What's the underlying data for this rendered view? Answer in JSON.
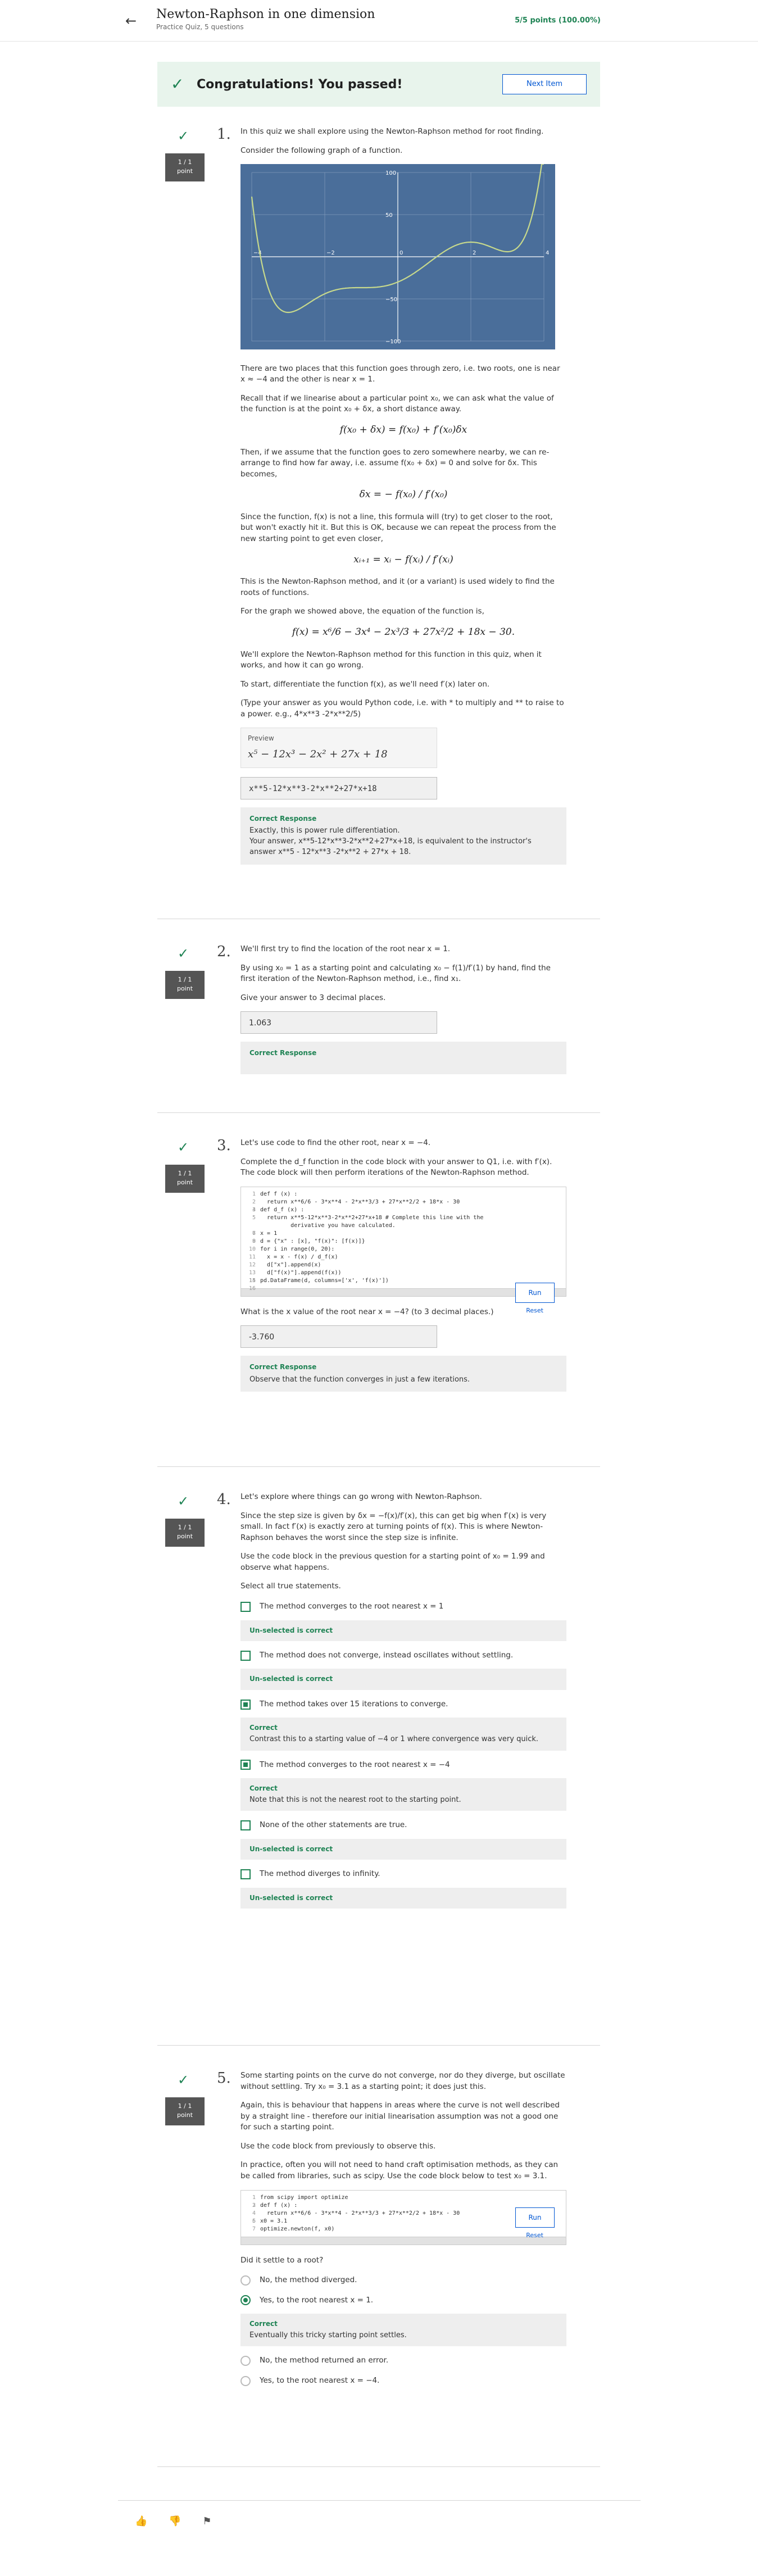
{
  "header": {
    "title": "Newton-Raphson in one dimension",
    "subtitle": "Practice Quiz, 5 questions",
    "score": "5/5 points (100.00%)"
  },
  "banner": {
    "message": "Congratulations! You passed!",
    "next_label": "Next Item"
  },
  "points_label": "1 / 1",
  "points_unit": "point",
  "q1": {
    "number": "1.",
    "p1": "In this quiz we shall explore using the Newton-Raphson method for root finding.",
    "p2": "Consider the following graph of a function.",
    "p3": "There are two places that this function goes through zero, i.e. two roots, one is near x ≈ −4 and the other is near x = 1.",
    "p4": "Recall that if we linearise about a particular point x₀, we can ask what the value of the function is at the point x₀ + δx, a short distance away.",
    "eq1": "f(x₀ + δx) = f(x₀) + f′(x₀)δx",
    "p5": "Then, if we assume that the function goes to zero somewhere nearby, we can re-arrange to find how far away, i.e. assume f(x₀ + δx) = 0 and solve for δx. This becomes,",
    "eq2": "δx = − f(x₀) / f′(x₀)",
    "p6": "Since the function, f(x) is not a line, this formula will (try) to get closer to the root, but won't exactly hit it. But this is OK, because we can repeat the process from the new starting point to get even closer,",
    "eq3": "xᵢ₊₁ = xᵢ − f(xᵢ) / f′(xᵢ)",
    "p7": "This is the Newton-Raphson method, and it (or a variant) is used widely to find the roots of functions.",
    "p8": "For the graph we showed above, the equation of the function is,",
    "eq4": "f(x) = x⁶/6 − 3x⁴ − 2x³/3 + 27x²/2 + 18x − 30.",
    "p9": "We'll explore the Newton-Raphson method for this function in this quiz, when it works, and how it can go wrong.",
    "p10": "To start, differentiate the function f(x), as we'll need f′(x) later on.",
    "p11": "(Type your answer as you would Python code, i.e. with * to multiply and ** to raise to a power. e.g., 4*x**3 -2*x**2/5)",
    "preview_label": "Preview",
    "preview_value": "x⁵ − 12x³ − 2x² + 27x + 18",
    "answer": "x**5-12*x**3-2*x**2+27*x+18",
    "resp_title": "Correct Response",
    "resp_line1": "Exactly, this is power rule differentiation.",
    "resp_line2": "Your answer, x**5-12*x**3-2*x**2+27*x+18, is equivalent to the instructor's answer x**5 - 12*x**3 -2*x**2 + 27*x + 18."
  },
  "chart_data": {
    "type": "line",
    "title": "",
    "xlabel": "",
    "ylabel": "",
    "xlim": [
      -4,
      4
    ],
    "ylim": [
      -100,
      100
    ],
    "xticks": [
      "−4",
      "−2",
      "0",
      "2",
      "4"
    ],
    "yticks": [
      "100",
      "50",
      "0",
      "−50",
      "−100"
    ],
    "grid": true,
    "colors": {
      "background": "#4a6e9a",
      "line": "#c7d98c",
      "grid": "#8ea6c4"
    },
    "function": "x^6/6 - 3x^4 - 2x^3/3 + 27x^2/2 + 18x - 30"
  },
  "q2": {
    "number": "2.",
    "p1": "We'll first try to find the location of the root near x = 1.",
    "p2": "By using x₀ = 1 as a starting point and calculating x₀ − f(1)/f′(1) by hand, find the first iteration of the Newton-Raphson method, i.e., find x₁.",
    "p3": "Give your answer to 3 decimal places.",
    "answer": "1.063",
    "resp_title": "Correct Response"
  },
  "q3": {
    "number": "3.",
    "p1": "Let's use code to find the other root, near x = −4.",
    "p2": "Complete the d_f function in the code block with your answer to Q1, i.e. with f′(x). The code block will then perform iterations of the Newton-Raphson method.",
    "code": [
      "def f (x) :",
      "  return x**6/6 - 3*x**4 - 2*x**3/3 + 27*x**2/2 + 18*x - 30",
      "",
      "def d_f (x) :",
      "  return x**5-12*x**3-2*x**2+27*x+18 # Complete this line with the",
      "         derivative you have calculated.",
      "",
      "x = 1",
      "",
      "d = {\"x\" : [x], \"f(x)\": [f(x)]}",
      "for i in range(0, 20):",
      "  x = x - f(x) / d_f(x)",
      "  d[\"x\"].append(x)",
      "  d[\"f(x)\"].append(f(x))",
      "",
      "pd.DataFrame(d, columns=['x', 'f(x)'])",
      ""
    ],
    "code_numbers": [
      "1",
      "2",
      "3",
      "4",
      "5",
      "",
      "6",
      "7",
      "8",
      "9",
      "10",
      "11",
      "12",
      "13",
      "14",
      "15",
      "16"
    ],
    "run_label": "Run",
    "reset_label": "Reset",
    "p3": "What is the x value of the root near x = −4? (to 3 decimal places.)",
    "answer": "-3.760",
    "resp_title": "Correct Response",
    "resp_text": "Observe that the function converges in just a few iterations."
  },
  "q4": {
    "number": "4.",
    "p1": "Let's explore where things can go wrong with Newton-Raphson.",
    "p2": "Since the step size is given by δx = −f(x)/f′(x), this can get big when f′(x) is very small. In fact f′(x) is exactly zero at turning points of f(x). This is where Newton-Raphson behaves the worst since the step size is infinite.",
    "p3": "Use the code block in the previous question for a starting point of x₀ = 1.99 and observe what happens.",
    "p4": "Select all true statements.",
    "options": [
      {
        "label": "The method converges to the root nearest x = 1",
        "checked": false,
        "fb_title": "Un-selected is correct",
        "fb_text": ""
      },
      {
        "label": "The method does not converge, instead oscillates without settling.",
        "checked": false,
        "fb_title": "Un-selected is correct",
        "fb_text": ""
      },
      {
        "label": "The method takes over 15 iterations to converge.",
        "checked": true,
        "fb_title": "Correct",
        "fb_text": "Contrast this to a starting value of −4 or 1 where convergence was very quick."
      },
      {
        "label": "The method converges to the root nearest x = −4",
        "checked": true,
        "fb_title": "Correct",
        "fb_text": "Note that this is not the nearest root to the starting point."
      },
      {
        "label": "None of the other statements are true.",
        "checked": false,
        "fb_title": "Un-selected is correct",
        "fb_text": ""
      },
      {
        "label": "The method diverges to infinity.",
        "checked": false,
        "fb_title": "Un-selected is correct",
        "fb_text": ""
      }
    ]
  },
  "q5": {
    "number": "5.",
    "p1": "Some starting points on the curve do not converge, nor do they diverge, but oscillate without settling. Try x₀ = 3.1 as a starting point; it does just this.",
    "p2": "Again, this is behaviour that happens in areas where the curve is not well described by a straight line - therefore our initial linearisation assumption was not a good one for such a starting point.",
    "p3": "Use the code block from previously to observe this.",
    "p4": "In practice, often you will not need to hand craft optimisation methods, as they can be called from libraries, such as scipy. Use the code block below to test x₀ = 3.1.",
    "code": [
      "from scipy import optimize",
      "",
      "def f (x) :",
      "  return x**6/6 - 3*x**4 - 2*x**3/3 + 27*x**2/2 + 18*x - 30",
      "",
      "x0 = 3.1",
      "optimize.newton(f, x0)"
    ],
    "code_numbers": [
      "1",
      "2",
      "3",
      "4",
      "5",
      "6",
      "7"
    ],
    "run_label": "Run",
    "reset_label": "Reset",
    "p5": "Did it settle to a root?",
    "options": [
      {
        "label": "No, the method diverged.",
        "checked": false
      },
      {
        "label": "Yes, to the root nearest x = 1.",
        "checked": true,
        "fb_title": "Correct",
        "fb_text": "Eventually this tricky starting point settles."
      },
      {
        "label": "No, the method returned an error.",
        "checked": false
      },
      {
        "label": "Yes, to the root nearest x = −4.",
        "checked": false
      }
    ]
  },
  "footer": {
    "icons": [
      "thumbs-up-icon",
      "thumbs-down-icon",
      "flag-icon"
    ]
  }
}
